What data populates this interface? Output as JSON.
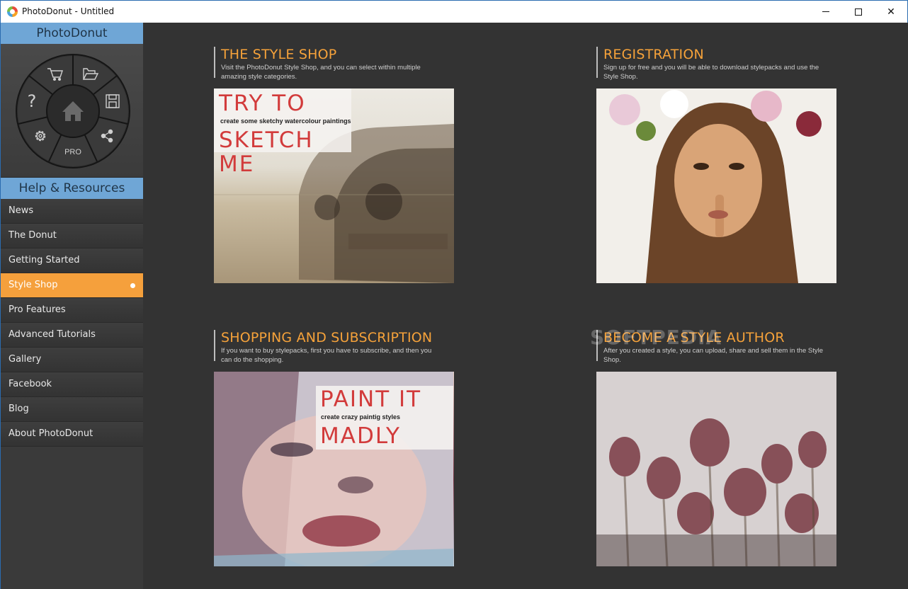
{
  "window": {
    "title": "PhotoDonut - Untitled",
    "controls": {
      "minimize": "minimize",
      "maximize": "maximize",
      "close": "✕"
    }
  },
  "sidebar": {
    "donut_header": "PhotoDonut",
    "donut_center_icon": "home-icon",
    "donut_segments": [
      {
        "icon": "cart-icon"
      },
      {
        "icon": "folder-open-icon"
      },
      {
        "icon": "save-icon"
      },
      {
        "icon": "share-icon"
      },
      {
        "label": "PRO"
      },
      {
        "icon": "gear-icon"
      },
      {
        "label": "?"
      }
    ],
    "resources_header": "Help & Resources",
    "items": [
      {
        "label": "News"
      },
      {
        "label": "The Donut"
      },
      {
        "label": "Getting Started"
      },
      {
        "label": "Style Shop",
        "active": true
      },
      {
        "label": "Pro Features"
      },
      {
        "label": "Advanced Tutorials"
      },
      {
        "label": "Gallery"
      },
      {
        "label": "Facebook"
      },
      {
        "label": "Blog"
      },
      {
        "label": "About PhotoDonut"
      }
    ]
  },
  "content": {
    "cards": [
      {
        "title": "THE STYLE SHOP",
        "desc": "Visit the PhotoDonut Style Shop, and you can select within multiple amazing style categories.",
        "overlay": {
          "line1": "TRY TO",
          "small": "create some sketchy watercolour paintings",
          "line2": "SKETCH ME"
        }
      },
      {
        "title": "REGISTRATION",
        "desc": "Sign up for free and you will be able to download stylepacks and use the Style Shop."
      },
      {
        "title": "SHOPPING AND SUBSCRIPTION",
        "desc": "If you want to buy stylepacks, first you have to subscribe, and then you can do the shopping.",
        "overlay": {
          "line1": "PAINT IT",
          "small": "create crazy  paintig styles",
          "line2": "MADLY"
        }
      },
      {
        "title": "BECOME A STYLE AUTHOR",
        "desc": "After you created a style, you can upload, share and sell them in the Style Shop."
      }
    ],
    "watermark": "SOFTPEDIA"
  },
  "colors": {
    "accent": "#f5a03c",
    "title_orange": "#f6a23a",
    "header_blue": "#6fa6d6",
    "background": "#333333"
  }
}
